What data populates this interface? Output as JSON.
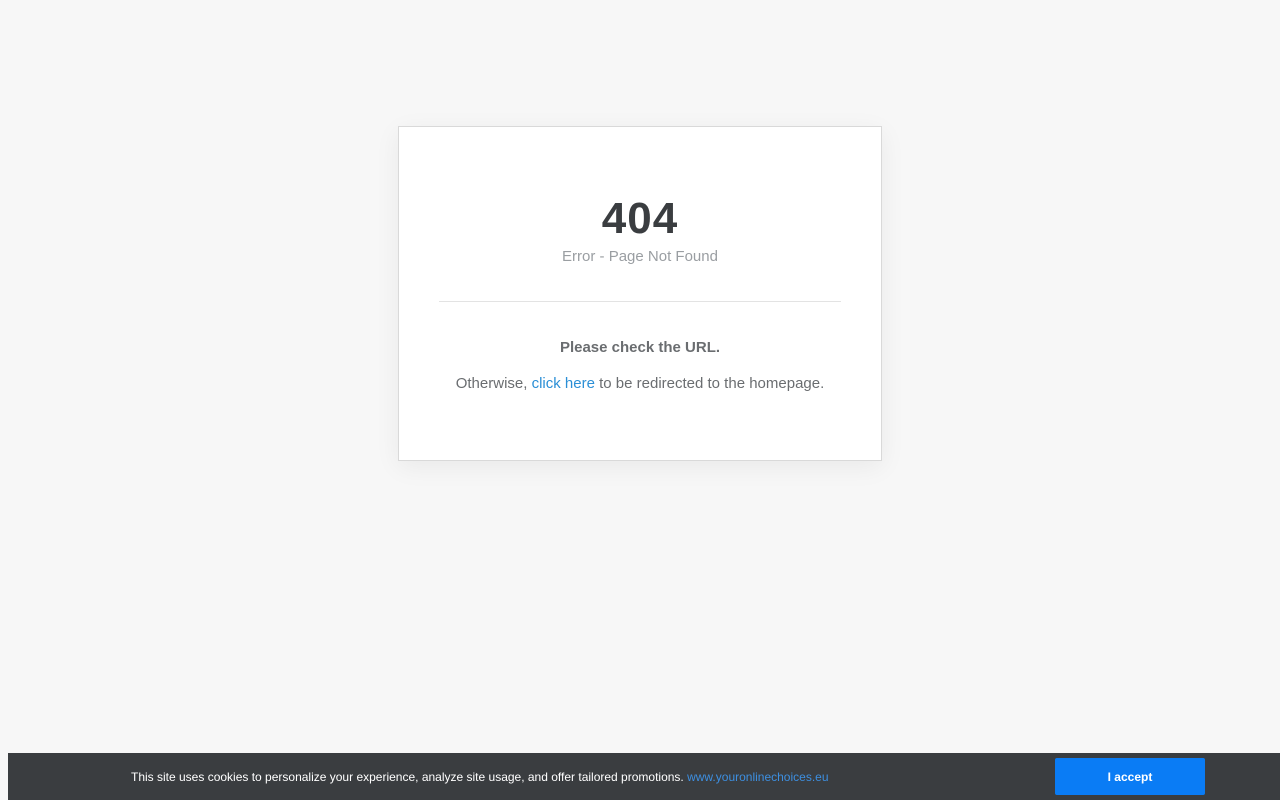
{
  "error": {
    "code": "404",
    "subtitle": "Error - Page Not Found",
    "check_message": "Please check the URL.",
    "redirect_prefix": "Otherwise, ",
    "redirect_link": "click here",
    "redirect_suffix": " to be redirected to the homepage."
  },
  "cookie_banner": {
    "text": "This site uses cookies to personalize your experience, analyze site usage, and offer tailored promotions. ",
    "link_text": "www.youronlinechoices.eu",
    "accept_label": "I accept"
  },
  "colors": {
    "background": "#f7f7f7",
    "card": "#ffffff",
    "link": "#2b8fd6",
    "cookie_bar": "#3a3d40",
    "accept_button": "#0a7cf5"
  }
}
